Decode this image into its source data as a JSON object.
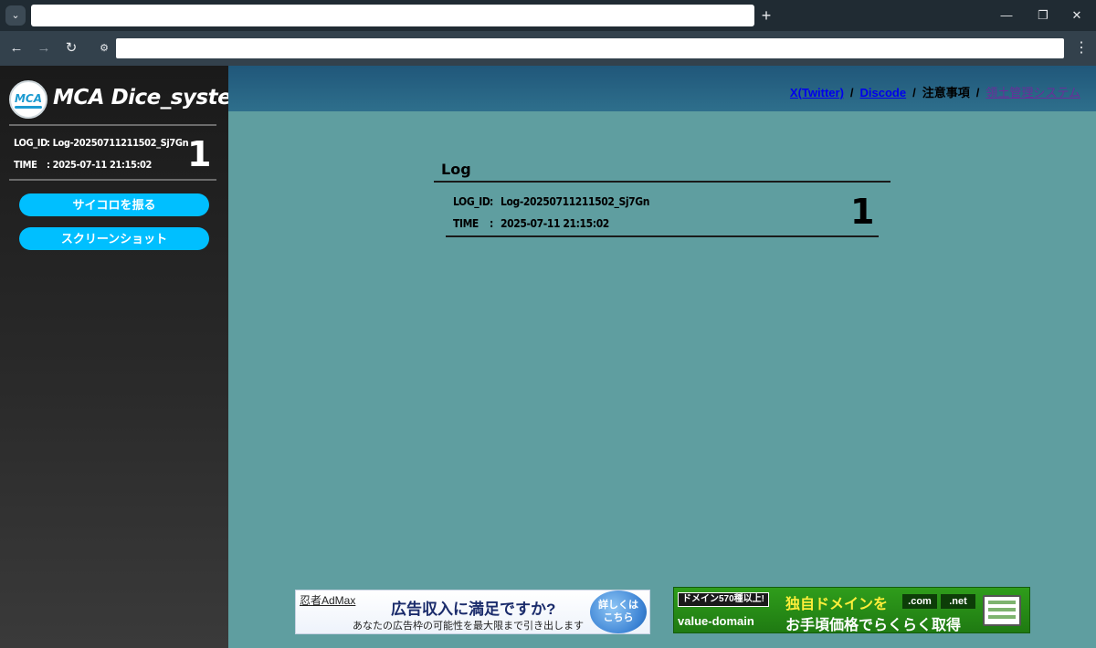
{
  "browser": {
    "tab_menu_icon": "chevron-down-icon",
    "new_tab_icon": "plus-icon",
    "new_tab_glyph": "+",
    "window_buttons": {
      "minimize": "—",
      "restore": "❐",
      "close": "✕"
    },
    "nav": {
      "back": "←",
      "forward": "→",
      "reload": "↻",
      "menu": "⋮",
      "site_info": "⚙"
    }
  },
  "sidebar": {
    "logo_text": "MCA",
    "brand": "MCA Dice_system",
    "log_id_key": "LOG_ID",
    "log_id_value": ": Log-20250711211502_Sj7Gn",
    "time_key": "TIME",
    "time_value": ": 2025-07-11 21:15:02",
    "result": "1",
    "buttons": {
      "roll": "サイコロを振る",
      "screenshot": "スクリーンショット"
    },
    "accent_color": "#00bfff"
  },
  "header": {
    "links": {
      "twitter": "X(Twitter)",
      "discord": "Discode",
      "notes": "注意事項",
      "system": "領土管理システム"
    },
    "separator": "/"
  },
  "log": {
    "title": "Log",
    "log_id_key": "LOG_ID",
    "colon": ":",
    "log_id_value": "Log-20250711211502_Sj7Gn",
    "time_key": "TIME",
    "time_value": "2025-07-11 21:15:02",
    "result": "1"
  },
  "ads": {
    "admax": {
      "brand": "忍者AdMax",
      "headline": "広告収入に満足ですか?",
      "sub": "あなたの広告枠の可能性を最大限まで引き出します",
      "badge_line1": "詳しくは",
      "badge_line2": "こちら"
    },
    "value_domain": {
      "tag": "ドメイン570種以上!",
      "headline": "独自ドメインを",
      "tld1": ".com",
      "tld2": ".net",
      "brand": "value-domain",
      "footer": "お手頃価格でらくらく取得"
    }
  }
}
